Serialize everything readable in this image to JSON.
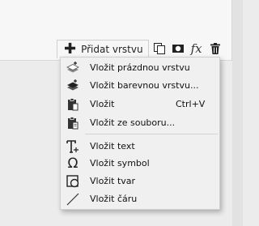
{
  "toolbar": {
    "add_layer_label": "Přidat vrstvu",
    "fx_label": "fx"
  },
  "menu": {
    "items": [
      {
        "label": "Vložit prázdnou vrstvu",
        "icon": "empty-layer-icon"
      },
      {
        "label": "Vložit barevnou vrstvu...",
        "icon": "color-layer-icon"
      },
      {
        "label": "Vložit",
        "shortcut": "Ctrl+V",
        "icon": "paste-icon"
      },
      {
        "label": "Vložit ze souboru...",
        "icon": "paste-from-file-icon"
      },
      {
        "label": "Vložit text",
        "icon": "text-icon"
      },
      {
        "label": "Vložit symbol",
        "icon": "symbol-icon"
      },
      {
        "label": "Vložit tvar",
        "icon": "shape-icon"
      },
      {
        "label": "Vložit čáru",
        "icon": "line-icon"
      }
    ]
  }
}
